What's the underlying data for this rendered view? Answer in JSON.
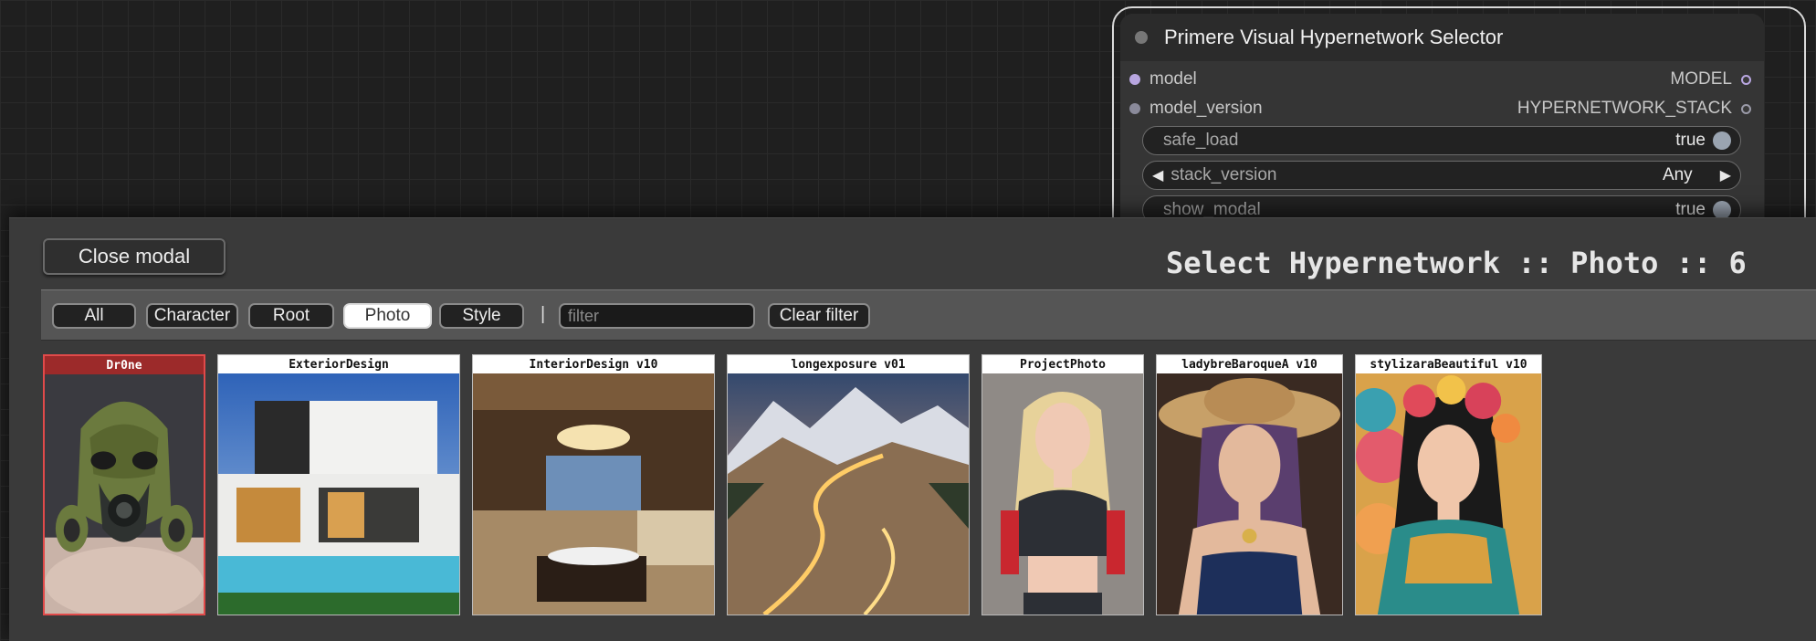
{
  "node": {
    "title": "Primere Visual Hypernetwork Selector",
    "inputs": [
      {
        "name": "model",
        "color": "#b8a6e0"
      },
      {
        "name": "model_version",
        "color": "#8a8a9a"
      }
    ],
    "outputs": [
      {
        "name": "MODEL",
        "color": "#b8a6e0"
      },
      {
        "name": "HYPERNETWORK_STACK",
        "color": "#9a9aa8"
      }
    ],
    "widgets": {
      "safe_load": {
        "label": "safe_load",
        "value": "true"
      },
      "stack_version": {
        "label": "stack_version",
        "value": "Any"
      },
      "show_modal": {
        "label": "show_modal",
        "value": "true"
      }
    }
  },
  "modal": {
    "close_label": "Close modal",
    "title": "Select Hypernetwork :: Photo :: 6",
    "filters": [
      "All",
      "Character",
      "Root",
      "Photo",
      "Style"
    ],
    "active_filter": "Photo",
    "separator": "|",
    "filter_placeholder": "filter",
    "filter_value": "",
    "clear_label": "Clear filter",
    "cards": [
      {
        "name": "Dr0ne",
        "selected": true,
        "image": "drone-mask"
      },
      {
        "name": "ExteriorDesign",
        "selected": false,
        "image": "modern-house"
      },
      {
        "name": "InteriorDesign v10",
        "selected": false,
        "image": "living-room"
      },
      {
        "name": "longexposure v01",
        "selected": false,
        "image": "mountain-road"
      },
      {
        "name": "ProjectPhoto",
        "selected": false,
        "image": "blonde-woman"
      },
      {
        "name": "ladybreBaroqueA v10",
        "selected": false,
        "image": "woman-hat"
      },
      {
        "name": "stylizaraBeautiful v10",
        "selected": false,
        "image": "woman-flowers"
      }
    ]
  },
  "colors": {
    "accent_selected": "#e04a4a",
    "modal_bg": "#3a3a3a",
    "node_bg": "#353535"
  }
}
